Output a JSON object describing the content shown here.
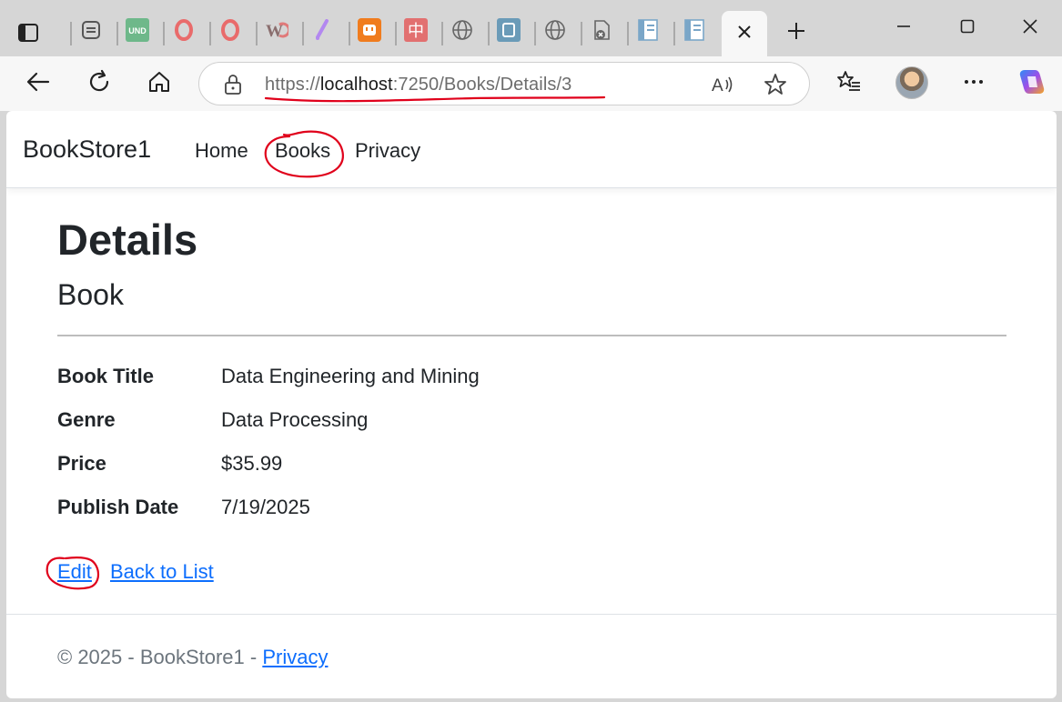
{
  "browser": {
    "tabs": [
      {
        "icon": "generic-page-icon"
      },
      {
        "icon": "und-icon",
        "text": "UND"
      },
      {
        "icon": "opera-icon"
      },
      {
        "icon": "opera-icon"
      },
      {
        "icon": "w-icon",
        "text": "W"
      },
      {
        "icon": "pen-icon"
      },
      {
        "icon": "plug-icon"
      },
      {
        "icon": "chinese-char-icon",
        "text": "中"
      },
      {
        "icon": "globe-icon"
      },
      {
        "icon": "doc-edit-icon"
      },
      {
        "icon": "globe-icon"
      },
      {
        "icon": "file-close-icon"
      },
      {
        "icon": "document-icon"
      },
      {
        "icon": "document-icon"
      }
    ],
    "url": {
      "scheme": "https://",
      "host": "localhost",
      "rest": ":7250/Books/Details/3"
    },
    "colors": {
      "link": "#0d6efd",
      "annotation": "#e0001b"
    }
  },
  "site": {
    "brand": "BookStore1",
    "nav": [
      "Home",
      "Books",
      "Privacy"
    ]
  },
  "page": {
    "title": "Details",
    "subtitle": "Book",
    "fields": [
      {
        "label": "Book Title",
        "value": "Data Engineering and Mining"
      },
      {
        "label": "Genre",
        "value": "Data Processing"
      },
      {
        "label": "Price",
        "value": "$35.99"
      },
      {
        "label": "Publish Date",
        "value": "7/19/2025"
      }
    ],
    "actions": {
      "edit": "Edit",
      "back": "Back to List"
    }
  },
  "footer": {
    "text": "© 2025 - BookStore1 - ",
    "link": "Privacy"
  }
}
